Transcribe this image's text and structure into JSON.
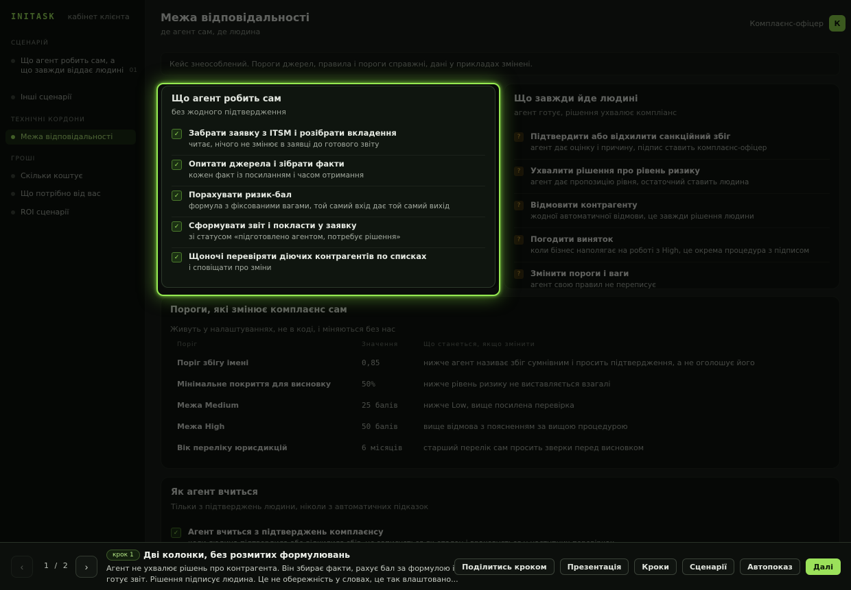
{
  "brand": {
    "logo": "INITASK",
    "subtitle": "кабінет клієнта"
  },
  "sidebar": {
    "sections": [
      {
        "title": "Сценарій",
        "items": [
          {
            "label": "Що агент робить сам, а що завжди віддає людині",
            "count": "01"
          },
          {
            "label": "Інші сценарії",
            "count": ""
          }
        ]
      },
      {
        "title": "Технічні кордони",
        "items": [
          {
            "label": "Межа відповідальності",
            "count": "",
            "active": true
          }
        ]
      },
      {
        "title": "Гроші",
        "items": [
          {
            "label": "Скільки коштує",
            "count": ""
          },
          {
            "label": "Що потрібно від вас",
            "count": ""
          },
          {
            "label": "ROI сценарії",
            "count": ""
          }
        ]
      }
    ]
  },
  "header": {
    "title": "Межа відповідальності",
    "subtitle": "де агент сам, де людина",
    "account": "Комплаєнс-офіцер",
    "avatar_letter": "К"
  },
  "notice": "Кейс знеособлений. Пороги джерел, правила і пороги справжні, дані у прикладах змінені.",
  "agent_card": {
    "title": "Що агент робить сам",
    "subtitle": "без жодного підтвердження",
    "items": [
      {
        "title": "Забрати заявку з ITSM і розібрати вкладення",
        "desc": "читає, нічого не змінює в заявці до готового звіту"
      },
      {
        "title": "Опитати джерела і зібрати факти",
        "desc": "кожен факт із посиланням і часом отримання"
      },
      {
        "title": "Порахувати ризик-бал",
        "desc": "формула з фіксованими вагами, той самий вхід дає той самий вихід"
      },
      {
        "title": "Сформувати звіт і покласти у заявку",
        "desc": "зі статусом «підготовлено агентом, потребує рішення»"
      },
      {
        "title": "Щоночі перевіряти діючих контрагентів по списках",
        "desc": "і сповіщати про зміни"
      }
    ]
  },
  "human_card": {
    "title": "Що завжди йде людині",
    "subtitle": "агент готує, рішення ухвалює компліанс",
    "items": [
      {
        "title": "Підтвердити або відхилити санкційний збіг",
        "desc": "агент дає оцінку і причину, підпис ставить комплаєнс-офіцер"
      },
      {
        "title": "Ухвалити рішення про рівень ризику",
        "desc": "агент дає пропозицію рівня, остаточний ставить людина"
      },
      {
        "title": "Відмовити контрагенту",
        "desc": "жодної автоматичної відмови, це завжди рішення людини"
      },
      {
        "title": "Погодити виняток",
        "desc": "коли бізнес наполягає на роботі з High, це окрема процедура з підписом"
      },
      {
        "title": "Змінити пороги і ваги",
        "desc": "агент свою правил не переписує"
      }
    ]
  },
  "thresholds": {
    "title": "Пороги, які змінює комплаєнс сам",
    "subtitle": "Живуть у налаштуваннях, не в коді, і міняються без нас",
    "columns": [
      "Поріг",
      "Значення",
      "Що станеться, якщо змінити"
    ],
    "rows": [
      {
        "name": "Поріг збігу імені",
        "value": "0,85",
        "desc": "нижче агент називає збіг сумнівним і просить підтвердження, а не оголошує його"
      },
      {
        "name": "Мінімальне покриття для висновку",
        "value": "50%",
        "desc": "нижче рівень ризику не виставляється взагалі"
      },
      {
        "name": "Межа Medium",
        "value": "25 балів",
        "desc": "нижче Low, вище посилена перевірка"
      },
      {
        "name": "Межа High",
        "value": "50 балів",
        "desc": "вище відмова з поясненням за вищою процедурою"
      },
      {
        "name": "Вік переліку юрисдикцій",
        "value": "6 місяців",
        "desc": "старший перелік сам просить зверки перед висновком"
      }
    ]
  },
  "learning": {
    "title": "Як агент вчиться",
    "subtitle": "Тільки з підтверджень людини, ніколи з автоматичних підказок",
    "items": [
      {
        "title": "Агент вчиться з підтверджень комплаєнсу",
        "desc": "коли людина підтвердила або відхилила збіг, це записується як еталон і враховується у наступних перевірках"
      }
    ]
  },
  "tour": {
    "current": "1",
    "total": "2",
    "separator": "/",
    "prev_glyph": "‹",
    "next_glyph": "›",
    "step_badge": "крок 1",
    "step_title": "Дві колонки, без розмитих формулювань",
    "step_desc": "Агент не ухвалює рішень про контрагента. Він збирає факти, рахує бал за формулою і готує звіт. Рішення підписує людина. Це не обережність у словах, це так влаштовано...",
    "actions": [
      "Поділитись кроком",
      "Презентація",
      "Кроки",
      "Сценарії",
      "Автопоказ"
    ],
    "primary": "Далі"
  },
  "colors": {
    "accent": "#9be15a",
    "warning": "#e0b040",
    "background": "#0a0c0a"
  }
}
